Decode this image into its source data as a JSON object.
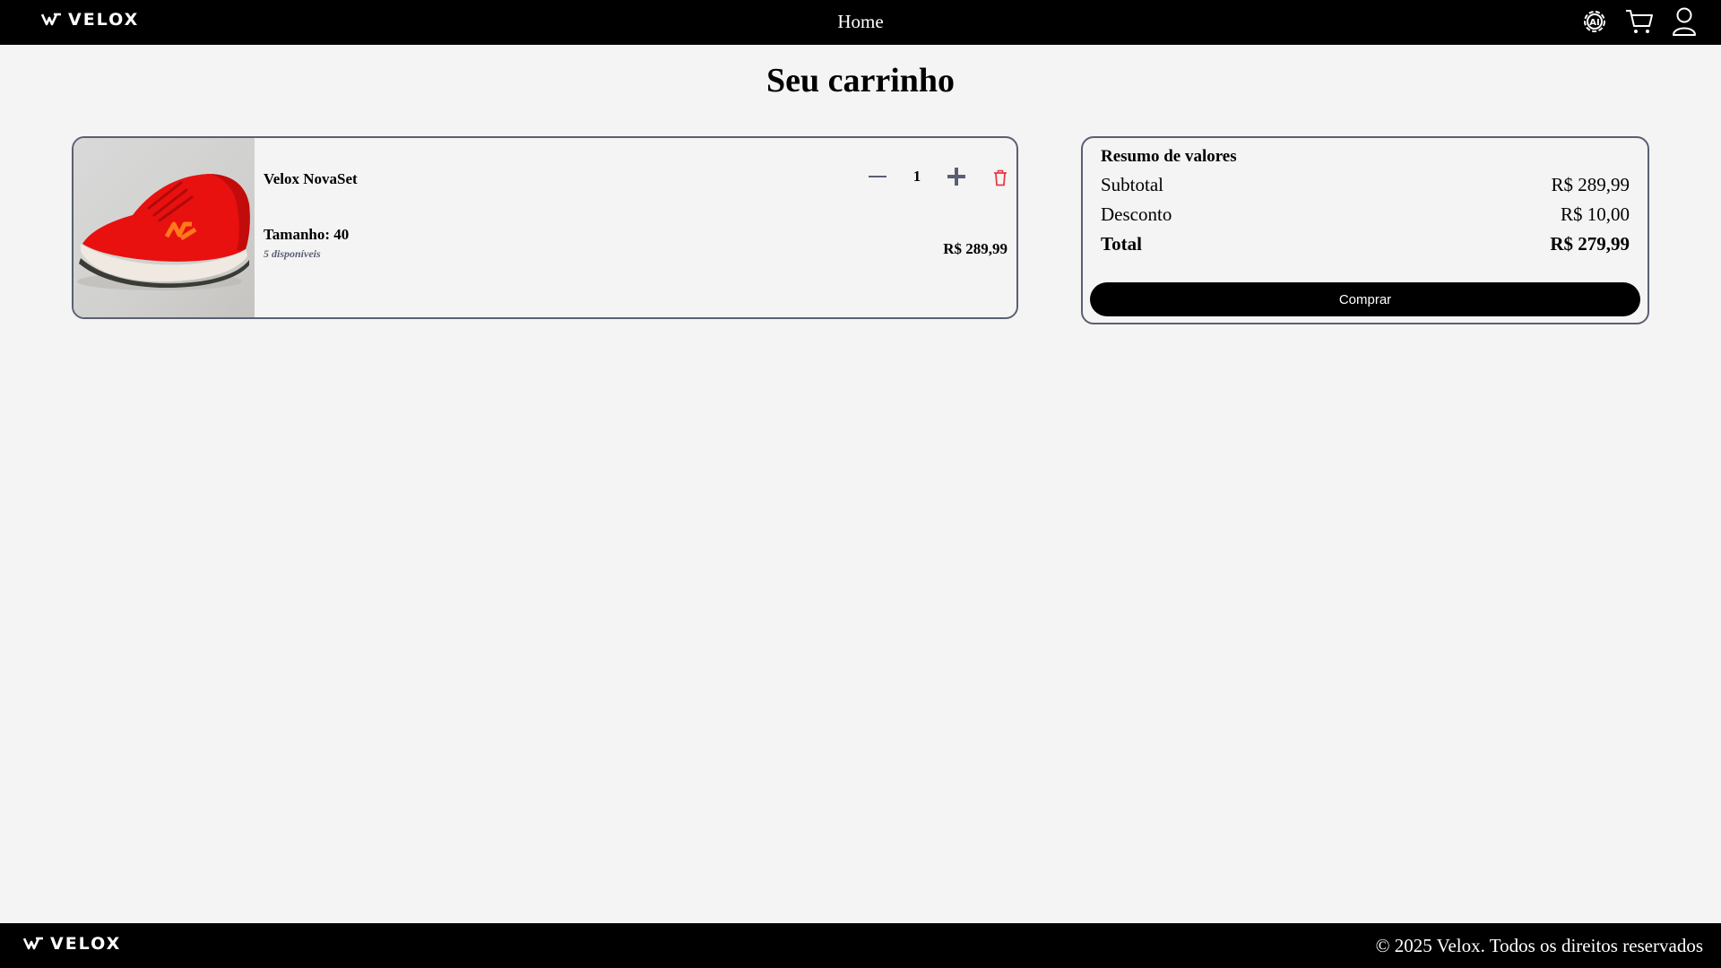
{
  "header": {
    "brand": "VELOX",
    "nav_home": "Home",
    "icons": [
      "settings-icon",
      "cart-icon",
      "user-icon"
    ]
  },
  "page": {
    "title": "Seu carrinho"
  },
  "cart": {
    "items": [
      {
        "name": "Velox NovaSet",
        "size_label": "Tamanho: 40",
        "stock": "5 disponíveis",
        "quantity": "1",
        "price": "R$ 289,99",
        "image": "red-running-shoe"
      }
    ]
  },
  "summary": {
    "title": "Resumo de valores",
    "subtotal_label": "Subtotal",
    "subtotal_value": "R$ 289,99",
    "discount_label": "Desconto",
    "discount_value": "R$ 10,00",
    "total_label": "Total",
    "total_value": "R$ 279,99",
    "buy_label": "Comprar"
  },
  "footer": {
    "brand": "VELOX",
    "copyright": "© 2025 Velox. Todos os direitos reservados"
  },
  "colors": {
    "background": "#f4f4f4",
    "bar": "#000000",
    "card_border": "#5a5f73",
    "delete": "#e53945",
    "shoe": "#e8110f",
    "shoe_logo": "#ff7a1a"
  }
}
